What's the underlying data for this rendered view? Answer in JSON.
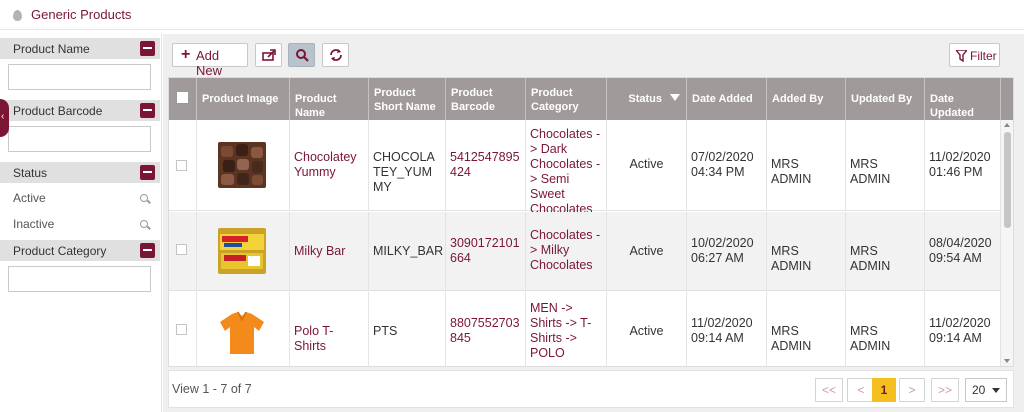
{
  "header": {
    "title": "Generic Products",
    "icon": "drop-icon"
  },
  "filters": {
    "product_name": {
      "label": "Product Name",
      "value": ""
    },
    "product_barcode": {
      "label": "Product Barcode",
      "value": ""
    },
    "status": {
      "label": "Status",
      "options": [
        "Active",
        "Inactive"
      ]
    },
    "product_category": {
      "label": "Product Category",
      "value": ""
    }
  },
  "toolbar": {
    "add_new_label": "Add New",
    "filter_label": "Filter"
  },
  "grid": {
    "columns": [
      "Product Image",
      "Product Name",
      "Product Short Name",
      "Product Barcode",
      "Product Category",
      "Status",
      "Date Added",
      "Added By",
      "Updated By",
      "Date Updated"
    ],
    "rows": [
      {
        "image": "chocolate-image",
        "name": "Chocolatey Yummy",
        "short_name": "CHOCOLATEY_YUMMY",
        "barcode": "5412547895424",
        "category": "Chocolates -> Dark Chocolates -> Semi Sweet Chocolates",
        "status": "Active",
        "date_added": "07/02/2020 04:34 PM",
        "added_by": "MRS ADMIN",
        "updated_by": "MRS ADMIN",
        "date_updated": "11/02/2020 01:46 PM"
      },
      {
        "image": "milky-bar-image",
        "name": "Milky Bar",
        "short_name": "MILKY_BAR",
        "barcode": "3090172101664",
        "category": "Chocolates -> Milky Chocolates",
        "status": "Active",
        "date_added": "10/02/2020 06:27 AM",
        "added_by": "MRS ADMIN",
        "updated_by": "MRS ADMIN",
        "date_updated": "08/04/2020 09:54 AM"
      },
      {
        "image": "polo-tshirt-image",
        "name": "Polo T-Shirts",
        "short_name": "PTS",
        "barcode": "8807552703845",
        "category": "MEN -> Shirts -> T-Shirts -> POLO",
        "status": "Active",
        "date_added": "11/02/2020 09:14 AM",
        "added_by": "MRS ADMIN",
        "updated_by": "MRS ADMIN",
        "date_updated": "11/02/2020 09:14 AM"
      }
    ]
  },
  "pagination": {
    "info": "View 1 - 7 of 7",
    "first": "<<",
    "prev": "<",
    "current": "1",
    "next": ">",
    "last": ">>",
    "page_size": "20"
  },
  "colors": {
    "accent": "#7a1634",
    "header_bg": "#a19a9a",
    "current_page": "#f4c01f"
  }
}
